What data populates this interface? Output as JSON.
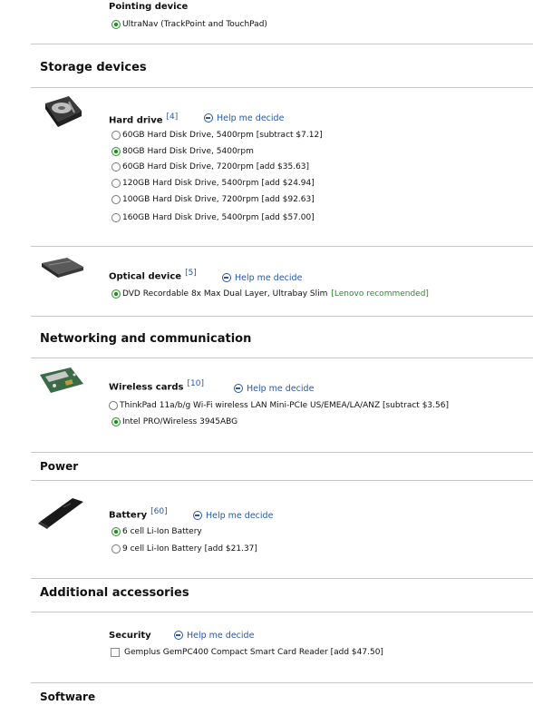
{
  "pointing": {
    "title": "Pointing device",
    "option": "UltraNav (TrackPoint and TouchPad)"
  },
  "storage": {
    "title": "Storage devices",
    "hard_drive": {
      "label": "Hard drive",
      "count": "[4]",
      "help": "Help me decide",
      "options": [
        "60GB Hard Disk Drive, 5400rpm [subtract $7.12]",
        "80GB Hard Disk Drive, 5400rpm",
        "60GB Hard Disk Drive, 7200rpm [add $35.63]",
        "120GB Hard Disk Drive, 5400rpm [add $24.94]",
        "100GB Hard Disk Drive, 7200rpm [add $92.63]",
        "160GB Hard Disk Drive, 5400rpm [add $57.00]"
      ]
    },
    "optical": {
      "label": "Optical device",
      "count": "[5]",
      "help": "Help me decide",
      "option": "DVD Recordable 8x Max Dual Layer, Ultrabay Slim",
      "recommended": "[Lenovo recommended]"
    }
  },
  "networking": {
    "title": "Networking and communication",
    "wireless": {
      "label": "Wireless cards",
      "count": "[10]",
      "help": "Help me decide",
      "options": [
        "ThinkPad 11a/b/g Wi-Fi wireless LAN Mini-PCIe US/EMEA/LA/ANZ [subtract $3.56]",
        "Intel PRO/Wireless 3945ABG"
      ]
    }
  },
  "power": {
    "title": "Power",
    "battery": {
      "label": "Battery",
      "count": "[60]",
      "help": "Help me decide",
      "options": [
        "6 cell Li-Ion Battery",
        "9 cell Li-Ion Battery [add $21.37]"
      ]
    }
  },
  "accessories": {
    "title": "Additional accessories",
    "security": {
      "label": "Security",
      "help": "Help me decide",
      "option": "Gemplus GemPC400 Compact Smart Card Reader [add $47.50]"
    }
  },
  "software": {
    "title": "Software"
  },
  "colors": {
    "link": "#2a57a6",
    "recommended": "#2e8b2e",
    "divider": "#c9c9c9"
  }
}
